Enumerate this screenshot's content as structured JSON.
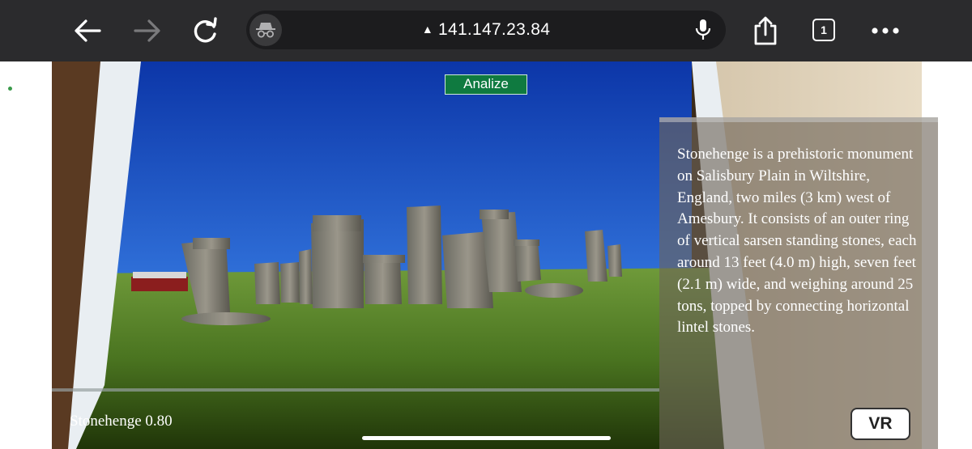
{
  "browser": {
    "url": "141.147.23.84",
    "url_warning_icon": "warning-triangle-icon",
    "tab_count": "1",
    "icons": {
      "back": "arrow-left-icon",
      "forward": "arrow-right-icon",
      "reload": "reload-icon",
      "incognito": "incognito-icon",
      "mic": "microphone-icon",
      "share": "share-icon",
      "menu": "more-dots-icon"
    }
  },
  "ar": {
    "analyze_label": "Analize",
    "description": "Stonehenge is a prehistoric monument on Salisbury Plain in Wiltshire, England, two miles (3 km) west of Amesbury. It consists of an outer ring of vertical sarsen standing stones, each around 13 feet (4.0 m) high, seven feet (2.1 m) wide, and weighing around 25 tons, topped by connecting horizontal lintel stones.",
    "detection_label": "Stonehenge 0.80",
    "vr_label": "VR"
  },
  "colors": {
    "toolbar": "#2b2b2d",
    "analyze_button": "#0f7a40",
    "sky_top": "#0f3fb6",
    "grass": "#4a7420"
  }
}
